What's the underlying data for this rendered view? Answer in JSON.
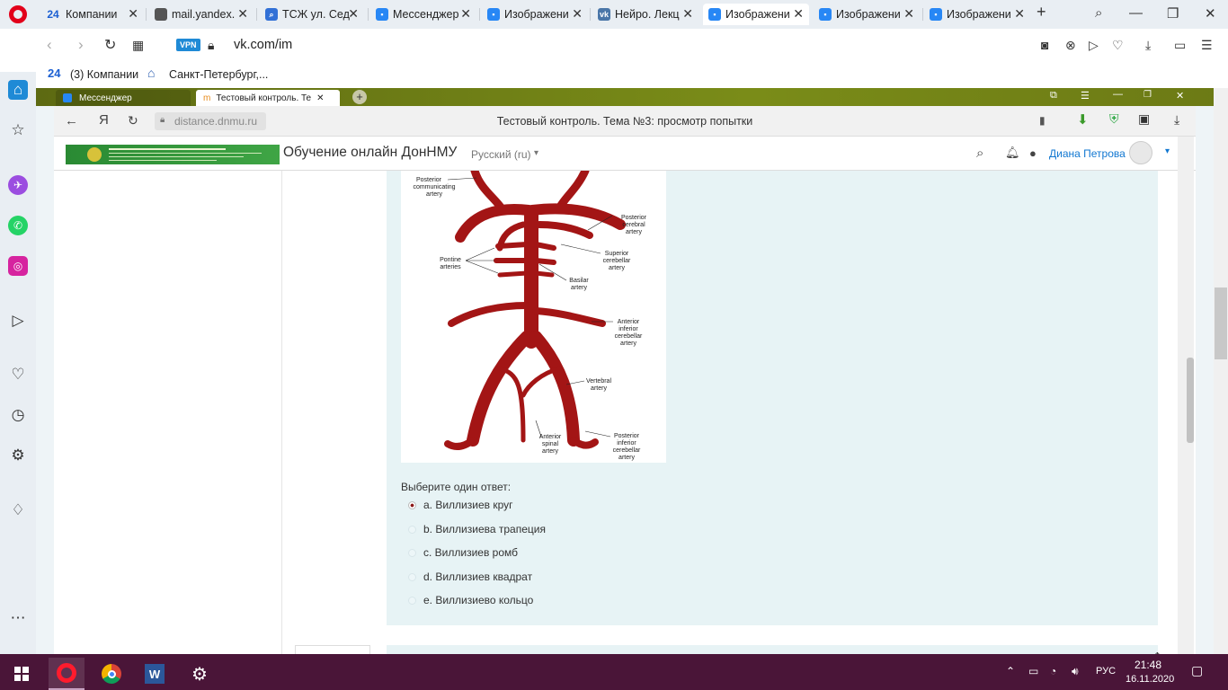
{
  "browser": {
    "tabs": [
      {
        "label": "Компании",
        "icon_text": "24",
        "icon_color": "#1b5fd2"
      },
      {
        "label": "mail.yandex.",
        "icon_text": "",
        "icon_color": "#555555"
      },
      {
        "label": "ТСЖ ул. Сед",
        "icon_text": "",
        "icon_color": "#3170d6"
      },
      {
        "label": "Мессенджер",
        "icon_text": "",
        "icon_color": "#2787f5"
      },
      {
        "label": "Изображени",
        "icon_text": "",
        "icon_color": "#2787f5"
      },
      {
        "label": "Нейро. Лекц",
        "icon_text": "",
        "icon_color": "#4a76a8"
      },
      {
        "label": "Изображени",
        "icon_text": "",
        "icon_color": "#2787f5"
      },
      {
        "label": "Изображени",
        "icon_text": "",
        "icon_color": "#2787f5"
      },
      {
        "label": "Изображени",
        "icon_text": "",
        "icon_color": "#2787f5"
      }
    ],
    "active_tab_index": 6,
    "vpn_label": "VPN",
    "url": "vk.com/im",
    "bookmarks": [
      {
        "label": "(3) Компании",
        "icon_text": "24"
      },
      {
        "label": "Санкт-Петербург,..."
      }
    ]
  },
  "inner": {
    "tabs": [
      {
        "label": "Мессенджер"
      },
      {
        "label": "Тестовый контроль. Те"
      }
    ],
    "address": "distance.dnmu.ru",
    "page_title": "Тестовый контроль. Тема №3: просмотр попытки",
    "site": {
      "title": "Обучение онлайн ДонНМУ",
      "language": "Русский (ru)",
      "user_name": "Диана Петрова"
    },
    "diagram_labels": {
      "posterior_communicating": [
        "Posterior",
        "communicating",
        "artery"
      ],
      "posterior_cerebral": [
        "Posterior",
        "cerebral",
        "artery"
      ],
      "superior_cerebellar": [
        "Superior",
        "cerebellar",
        "artery"
      ],
      "pontine": [
        "Pontine",
        "arteries"
      ],
      "basilar": [
        "Basilar",
        "artery"
      ],
      "anterior_inferior_cerebellar": [
        "Anterior",
        "inferior",
        "cerebellar",
        "artery"
      ],
      "vertebral": [
        "Vertebral",
        "artery"
      ],
      "anterior_spinal": [
        "Anterior",
        "spinal",
        "artery"
      ],
      "posterior_inferior_cerebellar": [
        "Posterior",
        "inferior",
        "cerebellar",
        "artery"
      ]
    },
    "question": {
      "prompt": "Выберите один ответ:",
      "options": [
        {
          "label": "a. Виллизиев круг",
          "selected": true
        },
        {
          "label": "b. Виллизиева трапеция",
          "selected": false
        },
        {
          "label": "c. Виллизиев ромб",
          "selected": false
        },
        {
          "label": "d. Виллизиев квадрат",
          "selected": false
        },
        {
          "label": "e. Виллизиево кольцо",
          "selected": false
        }
      ]
    }
  },
  "taskbar": {
    "time": "21:48",
    "date": "16.11.2020",
    "language": "РУС"
  },
  "colors": {
    "artery": "#a31515",
    "taskbar": "#4a1538",
    "accent": "#1177d1"
  }
}
